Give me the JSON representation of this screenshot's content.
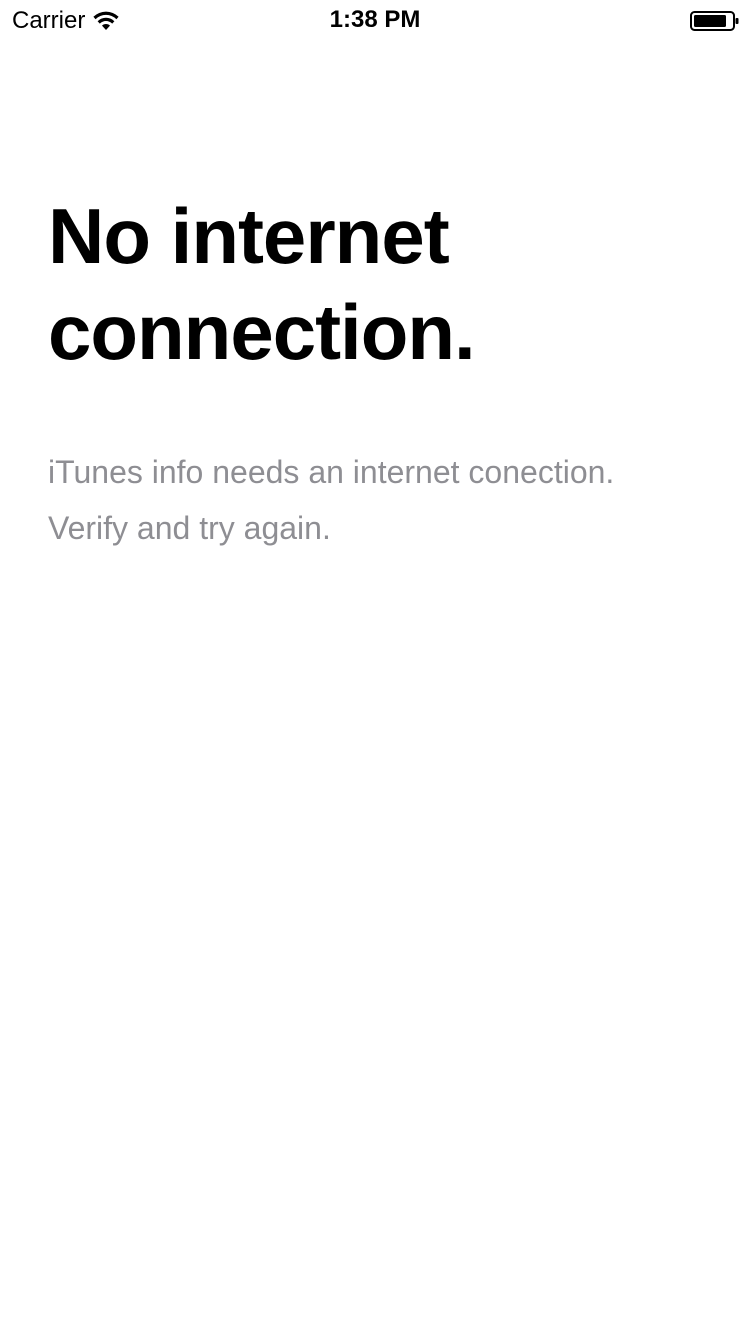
{
  "status_bar": {
    "carrier": "Carrier",
    "time": "1:38 PM",
    "wifi_icon": "wifi-icon",
    "battery_icon": "battery-icon"
  },
  "main": {
    "title_line_1": "No internet",
    "title_line_2": "connection.",
    "message_line_1": "iTunes info needs an internet conection.",
    "message_line_2": "Verify and try again."
  },
  "colors": {
    "title": "#000000",
    "message": "#8e8e93",
    "background": "#ffffff"
  }
}
